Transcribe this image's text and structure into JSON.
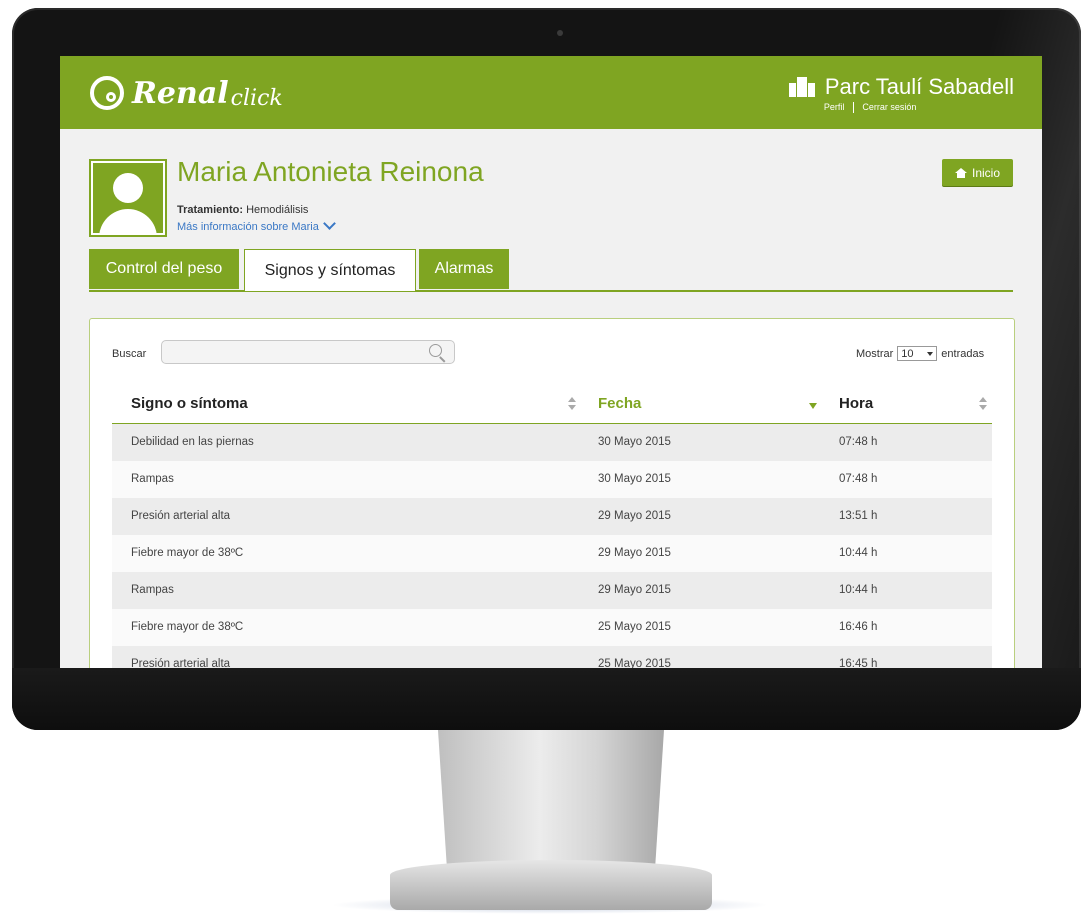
{
  "app": {
    "logo_text": "Renal",
    "logo_sub": "click"
  },
  "header": {
    "hospital_name": "Parc Taulí Sabadell",
    "profile_link": "Perfil",
    "logout_link": "Cerrar sesión"
  },
  "patient": {
    "name": "Maria Antonieta Reinona",
    "treatment_label": "Tratamiento:",
    "treatment_value": "Hemodiálisis",
    "more_info": "Más información sobre Maria"
  },
  "buttons": {
    "home": "Inicio"
  },
  "tabs": [
    {
      "label": "Control del peso"
    },
    {
      "label": "Signos y síntomas",
      "active": true
    },
    {
      "label": "Alarmas"
    }
  ],
  "table_controls": {
    "search_label": "Buscar",
    "search_value": "",
    "show_label": "Mostrar",
    "show_value": "10",
    "entries_label": "entradas"
  },
  "table": {
    "columns": [
      "Signo o síntoma",
      "Fecha",
      "Hora"
    ],
    "sorted_column": "Fecha",
    "rows": [
      [
        "Debilidad en las piernas",
        "30 Mayo 2015",
        "07:48 h"
      ],
      [
        "Rampas",
        "30 Mayo 2015",
        "07:48 h"
      ],
      [
        "Presión arterial alta",
        "29 Mayo 2015",
        "13:51 h"
      ],
      [
        "Fiebre mayor de 38ºC",
        "29 Mayo 2015",
        "10:44 h"
      ],
      [
        "Rampas",
        "29 Mayo 2015",
        "10:44 h"
      ],
      [
        "Fiebre mayor de 38ºC",
        "25 Mayo 2015",
        "16:46 h"
      ],
      [
        "Presión arterial alta",
        "25 Mayo 2015",
        "16:45 h"
      ]
    ]
  },
  "colors": {
    "brand_green": "#7fa522",
    "link_blue": "#3a78c5"
  }
}
